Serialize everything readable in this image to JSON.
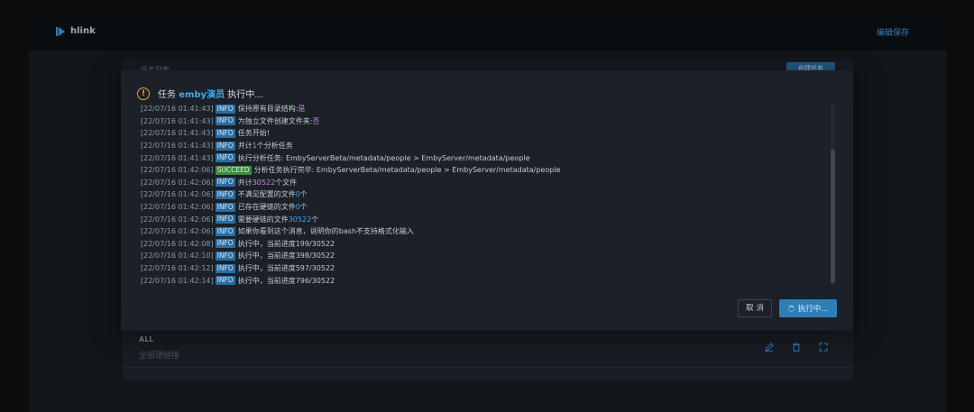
{
  "app": {
    "brand_name": "hlink",
    "top_action": "编辑保存",
    "brand_color": "#2f8fd8"
  },
  "background": {
    "card_title": "任务列表",
    "card_button": "创建任务",
    "row_label": "ALL",
    "row_sub": "全部硬链接",
    "row_icons": [
      "edit-icon",
      "delete-icon",
      "expand-icon"
    ]
  },
  "modal": {
    "title_prefix": "任务 ",
    "task_name": "emby演员",
    "title_suffix": " 执行中...",
    "cancel_label": "取 消",
    "run_label": "执行中...",
    "log": [
      {
        "time": "[22/07/16 01:41:43]",
        "level": "INFO",
        "msg": "保持原有目录结构: ",
        "hl": "是",
        "hl_color": "mag",
        "tail": ""
      },
      {
        "time": "[22/07/16 01:41:43]",
        "level": "INFO",
        "msg": "为独立文件创建文件夹: ",
        "hl": "否",
        "hl_color": "mag",
        "tail": ""
      },
      {
        "time": "[22/07/16 01:41:43]",
        "level": "INFO",
        "msg": "任务开始!",
        "hl": "",
        "hl_color": "",
        "tail": ""
      },
      {
        "time": "[22/07/16 01:41:43]",
        "level": "INFO",
        "msg": "共计 ",
        "hl": "1",
        "hl_color": "mag",
        "tail": " 个分析任务"
      },
      {
        "time": "[22/07/16 01:41:43]",
        "level": "INFO",
        "msg": "执行分析任务: EmbyServerBeta/metadata/people > EmbyServer/metadata/people",
        "hl": "",
        "hl_color": "",
        "tail": ""
      },
      {
        "time": "[22/07/16 01:42:06]",
        "level": "SUCCEED",
        "msg": "分析任务执行完毕: EmbyServerBeta/metadata/people > EmbyServer/metadata/people",
        "hl": "",
        "hl_color": "",
        "tail": ""
      },
      {
        "time": "[22/07/16 01:42:06]",
        "level": "INFO",
        "msg": "共计 ",
        "hl": "30522",
        "hl_color": "mag",
        "tail": " 个文件"
      },
      {
        "time": "[22/07/16 01:42:06]",
        "level": "INFO",
        "msg": "不满足配置的文件 ",
        "hl": "0",
        "hl_color": "blue",
        "tail": " 个"
      },
      {
        "time": "[22/07/16 01:42:06]",
        "level": "INFO",
        "msg": "已存在硬链的文件 ",
        "hl": "0",
        "hl_color": "blue",
        "tail": " 个"
      },
      {
        "time": "[22/07/16 01:42:06]",
        "level": "INFO",
        "msg": "需要硬链的文件 ",
        "hl": "30522",
        "hl_color": "blue",
        "tail": " 个"
      },
      {
        "time": "[22/07/16 01:42:06]",
        "level": "INFO",
        "msg": "如果你看到这个消息，说明你的bash不支持格式化输入",
        "hl": "",
        "hl_color": "",
        "tail": ""
      },
      {
        "time": "[22/07/16 01:42:08]",
        "level": "INFO",
        "msg": "执行中，当前进度199/30522",
        "hl": "",
        "hl_color": "",
        "tail": ""
      },
      {
        "time": "[22/07/16 01:42:10]",
        "level": "INFO",
        "msg": "执行中，当前进度398/30522",
        "hl": "",
        "hl_color": "",
        "tail": ""
      },
      {
        "time": "[22/07/16 01:42:12]",
        "level": "INFO",
        "msg": "执行中，当前进度597/30522",
        "hl": "",
        "hl_color": "",
        "tail": ""
      },
      {
        "time": "[22/07/16 01:42:14]",
        "level": "INFO",
        "msg": "执行中，当前进度796/30522",
        "hl": "",
        "hl_color": "",
        "tail": ""
      }
    ]
  },
  "colors": {
    "info_badge": "#2a6da3",
    "succeed_badge": "#3c8b3f",
    "warning": "#e9a23b",
    "accent_blue": "#4aa6e8",
    "accent_magenta": "#c58be0"
  }
}
